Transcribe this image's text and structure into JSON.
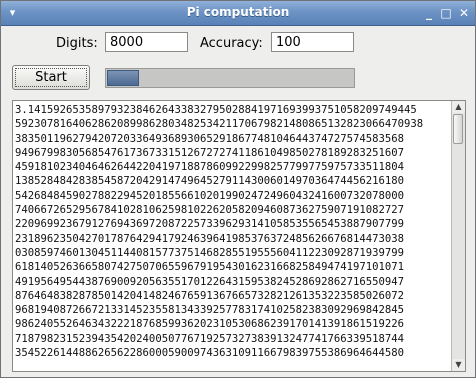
{
  "window": {
    "title": "Pi computation",
    "icons": {
      "system": "window-menu-icon",
      "minimize": "minimize-icon",
      "maximize": "maximize-icon",
      "close": "close-icon"
    }
  },
  "inputs": {
    "digits_label": "Digits:",
    "digits_value": "8000",
    "accuracy_label": "Accuracy:",
    "accuracy_value": "100"
  },
  "controls": {
    "start_label": "Start",
    "progress_fraction": 0.13
  },
  "output": {
    "lines": [
      "3.1415926535897932384626433832795028841971693993751058209749445",
      "5923078164062862089986280348253421170679821480865132823066470938",
      "3835011962794207203364936893065291867748104644374727574583568",
      "9496799830568547617367331512672727411861049850278189283251607",
      "4591810234046462644220419718878609922998257799775975733511804",
      "1385284842838545872042914749645279114300601497036474456216180",
      "5426848459027882294520185566102019902472496043241600732078000",
      "7406672652956784102810625981022620582094608736275907191082727",
      "2209699236791276943697208722573396293141058535565453887907799",
      "2318962350427017876429417924639641985376372485626676814473038",
      "0308597460130451144081577375146828551955560411223092871939799",
      "6181405263665807427507065596791954301623166825849474197101071",
      "4919564954438769009205635517012264315953824528692862716550947",
      "8764648382878501420414824676591367665732821261353223585026072",
      "9681940872667213314523558134339257783174102582383092969842845",
      "9862405526463432221876859936202310530686239170141391861519226",
      "7187982315239435420240050776719257327383913247741766339518744",
      "3545226144886265622860005900974363109116679839755386964644580"
    ]
  }
}
